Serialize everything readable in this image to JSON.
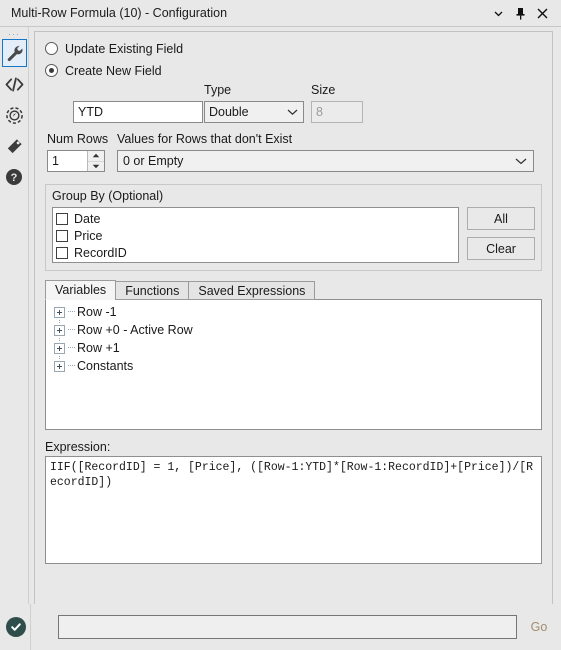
{
  "window": {
    "title": "Multi-Row Formula (10) - Configuration",
    "controls": [
      {
        "name": "chevron-down-icon",
        "label": "▾"
      },
      {
        "name": "pin-icon",
        "label": "⚑"
      },
      {
        "name": "close-icon",
        "label": "✕"
      }
    ]
  },
  "rail": {
    "grip": "···",
    "items": [
      {
        "name": "configuration-wrench-icon",
        "label": "Configuration",
        "selected": true
      },
      {
        "name": "code-icon",
        "label": "Code",
        "selected": false
      },
      {
        "name": "globe-icon",
        "label": "Globe",
        "selected": false
      },
      {
        "name": "tag-icon",
        "label": "Annotation",
        "selected": false
      },
      {
        "name": "help-icon",
        "label": "Help",
        "selected": false
      }
    ]
  },
  "form": {
    "update_existing_field": {
      "label": "Update Existing Field",
      "selected": false
    },
    "create_new_field": {
      "label": "Create New  Field",
      "selected": true
    },
    "field_name": {
      "label": "",
      "value": "YTD"
    },
    "type": {
      "label": "Type",
      "value": "Double"
    },
    "size": {
      "label": "Size",
      "value": "8",
      "enabled": false
    },
    "num_rows": {
      "label": "Num Rows",
      "value": "1"
    },
    "values_missing_rows": {
      "label": "Values for Rows that don't Exist",
      "value": "0 or Empty"
    }
  },
  "group_by": {
    "title": "Group By (Optional)",
    "items": [
      {
        "label": "Date",
        "checked": false
      },
      {
        "label": "Price",
        "checked": false
      },
      {
        "label": "RecordID",
        "checked": false
      }
    ],
    "all_button": "All",
    "clear_button": "Clear"
  },
  "tabs": [
    {
      "label": "Variables",
      "active": true
    },
    {
      "label": "Functions",
      "active": false
    },
    {
      "label": "Saved Expressions",
      "active": false
    }
  ],
  "tree": {
    "nodes": [
      {
        "label": "Row -1"
      },
      {
        "label": "Row +0 - Active Row"
      },
      {
        "label": "Row +1"
      },
      {
        "label": "Constants"
      }
    ]
  },
  "expression": {
    "label": "Expression:",
    "text": "IIF([RecordID] = 1, [Price], ([Row-1:YTD]*[Row-1:RecordID]+[Price])/[RecordID])"
  },
  "bottom": {
    "status_icon": "check-circle-icon",
    "search_value": "",
    "search_placeholder": "",
    "go_label": "Go"
  },
  "colors": {
    "accent_blue": "#1676c8",
    "status_green": "#2e4e4c",
    "go_tan": "#a08d6e",
    "window_bg": "#e8e8e8"
  }
}
